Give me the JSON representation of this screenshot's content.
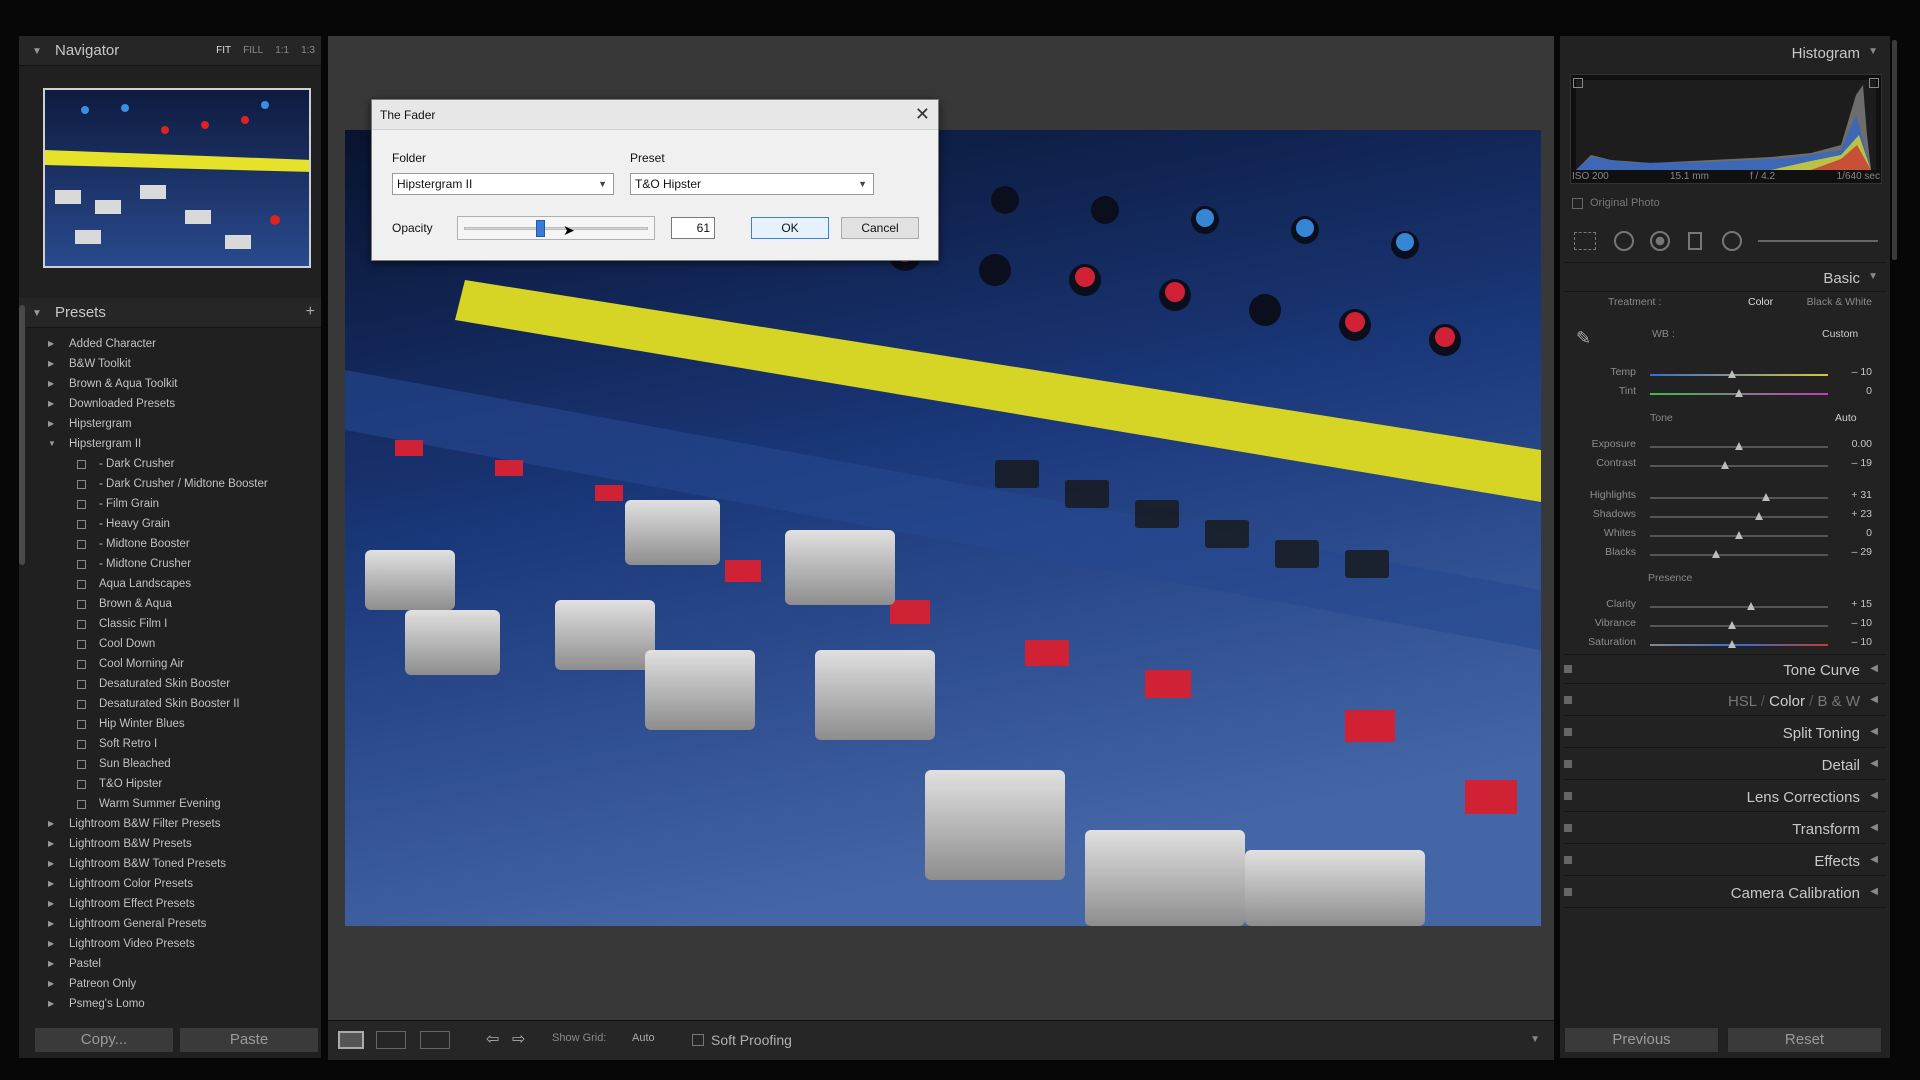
{
  "navigator": {
    "title": "Navigator",
    "options": [
      "FIT",
      "FILL",
      "1:1",
      "1:3"
    ]
  },
  "presets": {
    "title": "Presets",
    "add": "+",
    "items": [
      {
        "label": "Added Character",
        "kind": "folder",
        "open": false
      },
      {
        "label": "B&W Toolkit",
        "kind": "folder",
        "open": false
      },
      {
        "label": "Brown & Aqua Toolkit",
        "kind": "folder",
        "open": false
      },
      {
        "label": "Downloaded Presets",
        "kind": "folder",
        "open": false
      },
      {
        "label": "Hipstergram",
        "kind": "folder",
        "open": false
      },
      {
        "label": "Hipstergram II",
        "kind": "folder",
        "open": true
      },
      {
        "label": "- Dark Crusher",
        "kind": "preset"
      },
      {
        "label": "- Dark Crusher / Midtone Booster",
        "kind": "preset"
      },
      {
        "label": "- Film Grain",
        "kind": "preset"
      },
      {
        "label": "- Heavy Grain",
        "kind": "preset"
      },
      {
        "label": "- Midtone Booster",
        "kind": "preset"
      },
      {
        "label": "- Midtone Crusher",
        "kind": "preset"
      },
      {
        "label": "Aqua Landscapes",
        "kind": "preset"
      },
      {
        "label": "Brown & Aqua",
        "kind": "preset"
      },
      {
        "label": "Classic Film I",
        "kind": "preset"
      },
      {
        "label": "Cool Down",
        "kind": "preset"
      },
      {
        "label": "Cool Morning Air",
        "kind": "preset"
      },
      {
        "label": "Desaturated Skin Booster",
        "kind": "preset"
      },
      {
        "label": "Desaturated Skin Booster II",
        "kind": "preset"
      },
      {
        "label": "Hip Winter Blues",
        "kind": "preset"
      },
      {
        "label": "Soft Retro I",
        "kind": "preset"
      },
      {
        "label": "Sun Bleached",
        "kind": "preset"
      },
      {
        "label": "T&O Hipster",
        "kind": "preset"
      },
      {
        "label": "Warm Summer Evening",
        "kind": "preset"
      },
      {
        "label": "Lightroom B&W Filter Presets",
        "kind": "folder",
        "open": false
      },
      {
        "label": "Lightroom B&W Presets",
        "kind": "folder",
        "open": false
      },
      {
        "label": "Lightroom B&W Toned Presets",
        "kind": "folder",
        "open": false
      },
      {
        "label": "Lightroom Color Presets",
        "kind": "folder",
        "open": false
      },
      {
        "label": "Lightroom Effect Presets",
        "kind": "folder",
        "open": false
      },
      {
        "label": "Lightroom General Presets",
        "kind": "folder",
        "open": false
      },
      {
        "label": "Lightroom Video Presets",
        "kind": "folder",
        "open": false
      },
      {
        "label": "Pastel",
        "kind": "folder",
        "open": false
      },
      {
        "label": "Patreon Only",
        "kind": "folder",
        "open": false
      },
      {
        "label": "Psmeg's Lomo",
        "kind": "folder",
        "open": false
      }
    ]
  },
  "left_buttons": {
    "copy": "Copy...",
    "paste": "Paste"
  },
  "toolbar": {
    "show_grid_label": "Show Grid:",
    "show_grid_value": "Auto",
    "soft_proofing": "Soft Proofing"
  },
  "dialog": {
    "title": "The Fader",
    "close": "✕",
    "folder_label": "Folder",
    "folder_value": "Hipstergram II",
    "preset_label": "Preset",
    "preset_value": "T&O Hipster",
    "opacity_label": "Opacity",
    "opacity_value": "61",
    "opacity_level": 0.61,
    "ok": "OK",
    "cancel": "Cancel"
  },
  "histogram": {
    "title": "Histogram",
    "iso": "ISO 200",
    "focal": "15.1 mm",
    "aperture": "f / 4.2",
    "shutter": "1/640 sec",
    "original_photo": "Original Photo"
  },
  "basic": {
    "title": "Basic",
    "treatment_label": "Treatment :",
    "treatment_color": "Color",
    "treatment_bw": "Black & White",
    "wb_label": "WB :",
    "wb_value": "Custom",
    "tone_label": "Tone",
    "auto": "Auto",
    "presence_label": "Presence",
    "sliders": [
      {
        "name": "Temp",
        "value": "– 10",
        "level": 0.46,
        "group": "wb"
      },
      {
        "name": "Tint",
        "value": "0",
        "level": 0.5,
        "group": "wb"
      },
      {
        "name": "Exposure",
        "value": "0.00",
        "level": 0.5,
        "group": "tone"
      },
      {
        "name": "Contrast",
        "value": "– 19",
        "level": 0.42,
        "group": "tone"
      },
      {
        "name": "Highlights",
        "value": "+ 31",
        "level": 0.65,
        "group": "tone2"
      },
      {
        "name": "Shadows",
        "value": "+ 23",
        "level": 0.61,
        "group": "tone2"
      },
      {
        "name": "Whites",
        "value": "0",
        "level": 0.5,
        "group": "tone2"
      },
      {
        "name": "Blacks",
        "value": "– 29",
        "level": 0.37,
        "group": "tone2"
      },
      {
        "name": "Clarity",
        "value": "+ 15",
        "level": 0.57,
        "group": "presence"
      },
      {
        "name": "Vibrance",
        "value": "– 10",
        "level": 0.46,
        "group": "presence"
      },
      {
        "name": "Saturation",
        "value": "– 10",
        "level": 0.46,
        "group": "presence"
      }
    ]
  },
  "panels": {
    "tone_curve": "Tone Curve",
    "hsl": "HSL",
    "color": "Color",
    "bw": "B & W",
    "split_toning": "Split Toning",
    "detail": "Detail",
    "lens_corrections": "Lens Corrections",
    "transform": "Transform",
    "effects": "Effects",
    "camera_calibration": "Camera Calibration"
  },
  "right_buttons": {
    "previous": "Previous",
    "reset": "Reset"
  }
}
